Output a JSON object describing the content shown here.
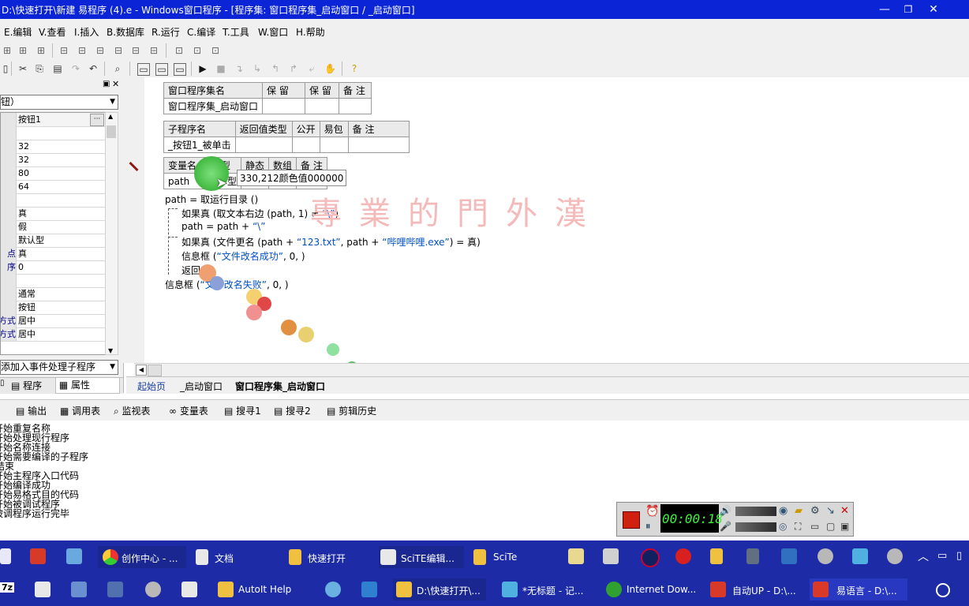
{
  "window": {
    "title": "D:\\快速打开\\新建 易程序 (4).e - Windows窗口程序 - [程序集: 窗口程序集_启动窗口 / _启动窗口]"
  },
  "menu": [
    "E.编辑",
    "V.查看",
    "I.插入",
    "B.数据库",
    "R.运行",
    "C.编译",
    "T.工具",
    "W.窗口",
    "H.帮助"
  ],
  "prop_panel": {
    "combo": "钮）",
    "rows": [
      {
        "name": "",
        "value": "按钮1"
      },
      {
        "name": "",
        "value": ""
      },
      {
        "name": "",
        "value": "32"
      },
      {
        "name": "",
        "value": "32"
      },
      {
        "name": "",
        "value": "80"
      },
      {
        "name": "",
        "value": "64"
      },
      {
        "name": "",
        "value": ""
      },
      {
        "name": "",
        "value": "真"
      },
      {
        "name": "",
        "value": "假"
      },
      {
        "name": "",
        "value": "默认型"
      },
      {
        "name": "点",
        "value": "真"
      },
      {
        "name": "序",
        "value": "0"
      },
      {
        "name": "",
        "value": ""
      },
      {
        "name": "",
        "value": "通常"
      },
      {
        "name": "",
        "value": "按钮"
      },
      {
        "name": "方式",
        "value": "居中"
      },
      {
        "name": "方式",
        "value": "居中"
      }
    ],
    "event_combo": "添加入事件处理子程序",
    "tab_program": "程序",
    "tab_property": "属性"
  },
  "assembly_table": {
    "headers": [
      "窗口程序集名",
      "保 留",
      "保 留",
      "备 注"
    ],
    "row": [
      "窗口程序集_启动窗口",
      "",
      "",
      ""
    ]
  },
  "sub_table": {
    "headers": [
      "子程序名",
      "返回值类型",
      "公开",
      "易包",
      "备 注"
    ],
    "row": [
      "_按钮1_被单击",
      "",
      "",
      "",
      ""
    ]
  },
  "var_table": {
    "headers": [
      "变量名",
      "类 型",
      "静态",
      "数组",
      "备 注"
    ],
    "row": [
      "path",
      "文本型",
      "",
      "",
      ""
    ]
  },
  "tooltip": "330,212颜色值000000",
  "code": {
    "l1_a": "path = ",
    "l1_b": "取运行目录 ()",
    "l2_a": "如果真 (取文本右边 (path, 1) ≠ ",
    "l2_s": "“\\”",
    "l2_b": ")",
    "l3_a": "path = path + ",
    "l3_s": "“\\”",
    "l4_a": "如果真 (文件更名 (path + ",
    "l4_s1": "“123.txt”",
    "l4_b": ", path + ",
    "l4_s2": "“哔哩哔哩.exe”",
    "l4_c": ") = 真)",
    "l5_a": "信息框 (",
    "l5_s": "“文件改名成功”",
    "l5_b": ", 0, )",
    "l6": "返回 ()",
    "l7_a": "信息框 (",
    "l7_s": "“文件改名失败”",
    "l7_b": ", 0, )"
  },
  "watermark": "專業的門外漢",
  "doc_tabs": [
    "起始页",
    "_启动窗口",
    "窗口程序集_启动窗口"
  ],
  "bottom_tabs": [
    "输出",
    "调用表",
    "监视表",
    "变量表",
    "搜寻1",
    "搜寻2",
    "剪辑历史"
  ],
  "output_lines": [
    "开始重复名称",
    "开始处理现行程序",
    "开始名称连接",
    "开始需要编译的子程序",
    "结束",
    "开始主程序入口代码",
    "开始编译成功",
    "开始易格式目的代码",
    "开始被调试程序",
    "被调程序运行完毕"
  ],
  "recorder": {
    "time": "00:00:18"
  },
  "taskbar1": [
    "创作中心 - ...",
    "文档",
    "快速打开",
    "SciTE编辑...",
    "SciTe"
  ],
  "taskbar2": [
    "AutoIt Help",
    "D:\\快速打开\\...",
    "*无标题 - 记...",
    "Internet Dow...",
    "自动UP - D:\\...",
    "易语言 - D:\\..."
  ],
  "colors": {
    "titlebar": "#0a24d6",
    "taskbar": "#1d2ca6",
    "string": "#0050c8",
    "watermark": "#f4b9b9"
  }
}
